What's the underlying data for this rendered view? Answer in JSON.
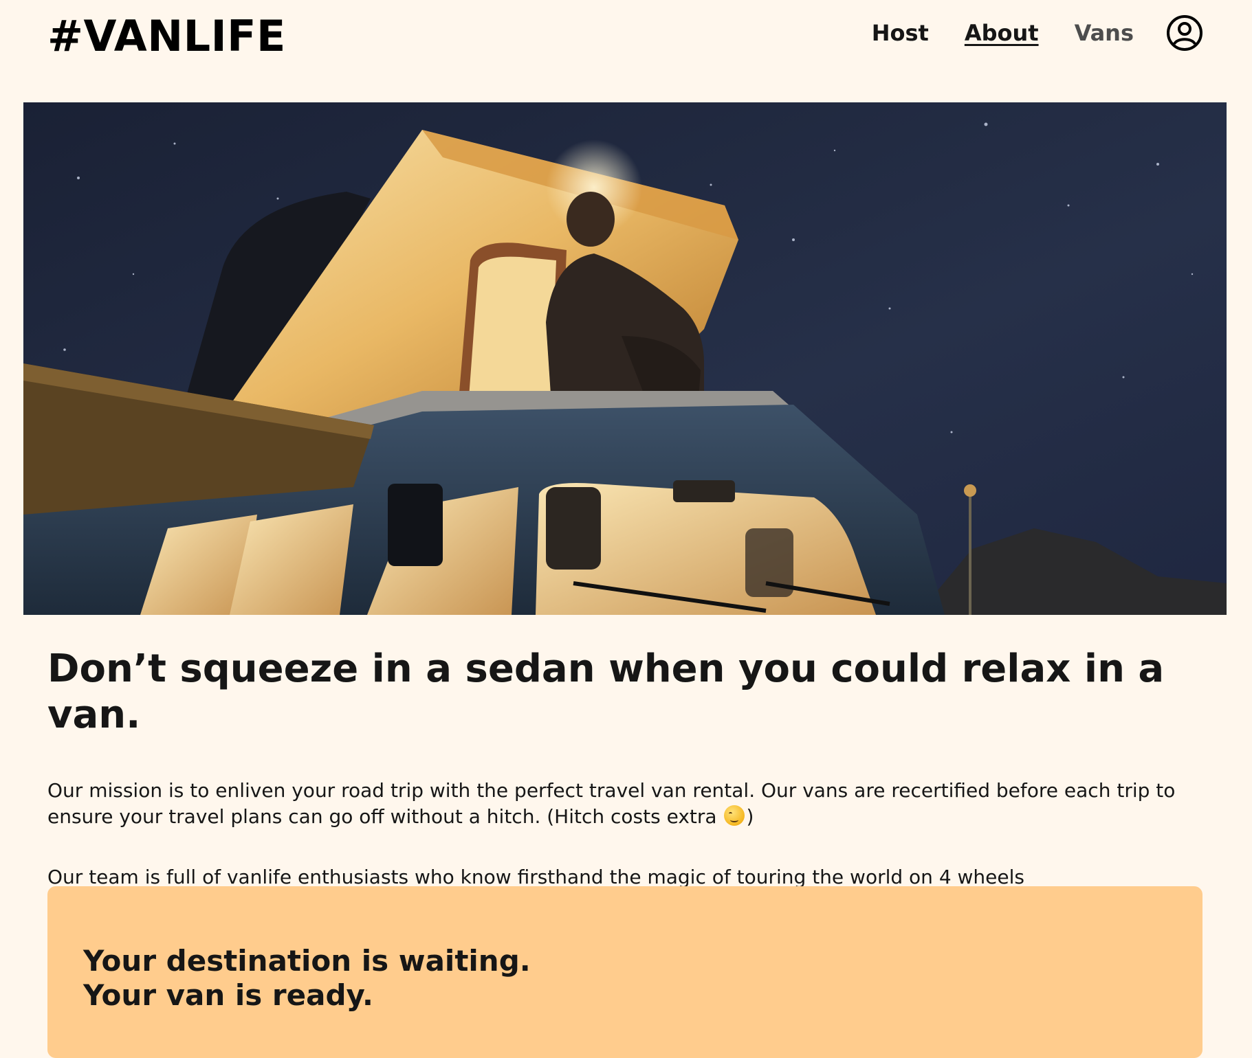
{
  "header": {
    "logo": "#VANLIFE",
    "nav": [
      {
        "label": "Host",
        "state": "default"
      },
      {
        "label": "About",
        "state": "active"
      },
      {
        "label": "Vans",
        "state": "muted"
      }
    ],
    "avatar_icon": "user-circle-icon"
  },
  "hero": {
    "image_icon": "van-night-photo"
  },
  "main": {
    "headline": "Don’t squeeze in a sedan when you could relax in a van.",
    "mission_text": "Our mission is to enliven your road trip with the perfect travel van rental. Our vans are recertified before each trip to ensure your travel plans can go off without a hitch. (Hitch costs extra",
    "mission_close": ")",
    "team_text": "Our team is full of vanlife enthusiasts who know firsthand the magic of touring the world on 4 wheels"
  },
  "cta": {
    "line1": "Your destination is waiting.",
    "line2": "Your van is ready."
  },
  "colors": {
    "background": "#FFF7ED",
    "cta_background": "#FFCC8D",
    "text": "#161616"
  }
}
